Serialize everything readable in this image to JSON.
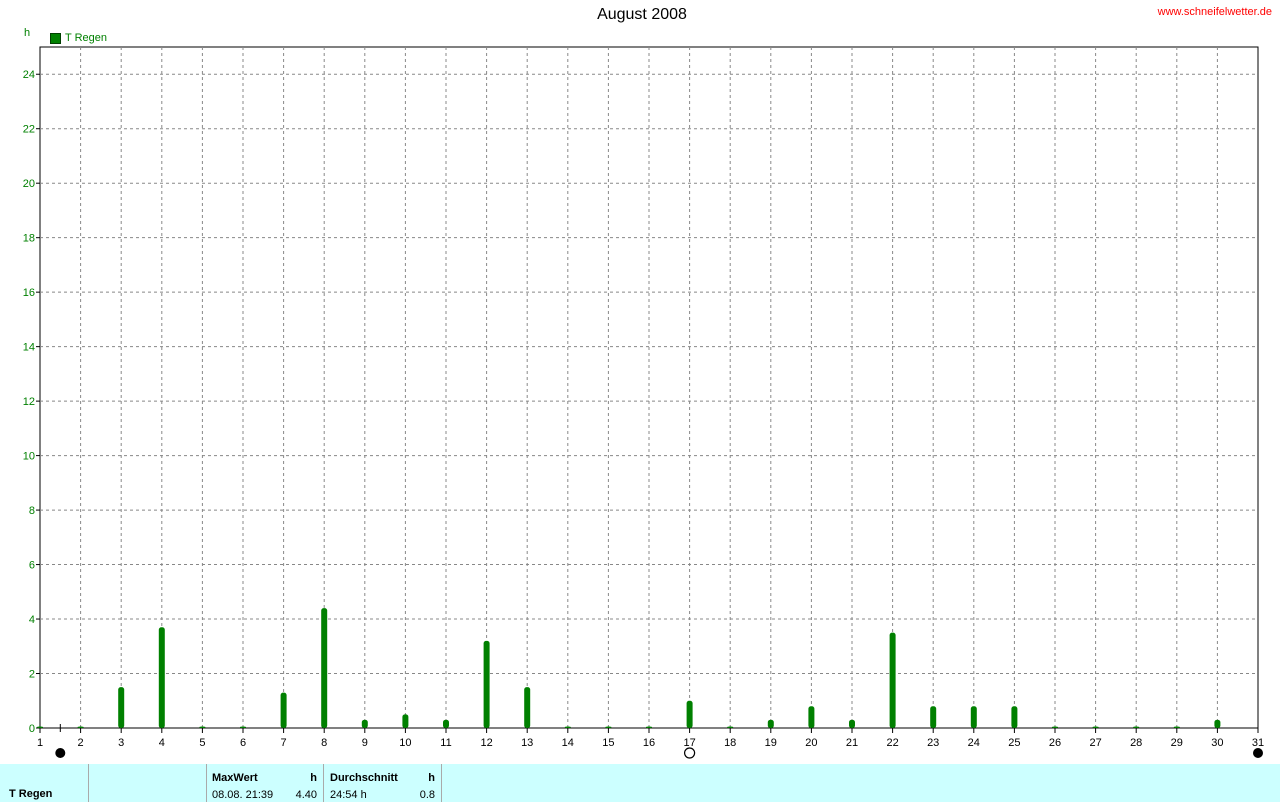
{
  "header": {
    "title": "August 2008",
    "source": "www.schneifelwetter.de",
    "unit": "h"
  },
  "legend": {
    "label": "T Regen",
    "color": "#008000"
  },
  "chart_data": {
    "type": "bar",
    "title": "August 2008",
    "ylabel": "h",
    "ylim": [
      0,
      25
    ],
    "yticks": [
      0,
      2,
      4,
      6,
      8,
      10,
      12,
      14,
      16,
      18,
      20,
      22,
      24
    ],
    "categories": [
      "1",
      "2",
      "3",
      "4",
      "5",
      "6",
      "7",
      "8",
      "9",
      "10",
      "11",
      "12",
      "13",
      "14",
      "15",
      "16",
      "17",
      "18",
      "19",
      "20",
      "21",
      "22",
      "23",
      "24",
      "25",
      "26",
      "27",
      "28",
      "29",
      "30",
      "31"
    ],
    "series": [
      {
        "name": "T Regen",
        "color": "#008000",
        "values": [
          0,
          0,
          1.5,
          3.7,
          0,
          0,
          1.3,
          4.4,
          0.3,
          0.5,
          0.3,
          3.2,
          1.5,
          0,
          0,
          0,
          1.0,
          0,
          0.3,
          0.8,
          0.3,
          3.5,
          0.8,
          0.8,
          0.8,
          0,
          0,
          0,
          0,
          0.3
        ]
      }
    ],
    "grid": true,
    "legend_position": "top-left",
    "moon_phases": [
      {
        "day": 1.5,
        "phase": "new"
      },
      {
        "day": 17,
        "phase": "full"
      },
      {
        "day": 31,
        "phase": "new"
      }
    ]
  },
  "footer": {
    "row_label": "T Regen",
    "max_label": "MaxWert",
    "max_unit": "h",
    "max_datetime": "08.08.  21:39",
    "max_value": "4.40",
    "avg_label": "Durchschnitt",
    "avg_unit": "h",
    "avg_total": "24:54 h",
    "avg_value": "0.8"
  }
}
